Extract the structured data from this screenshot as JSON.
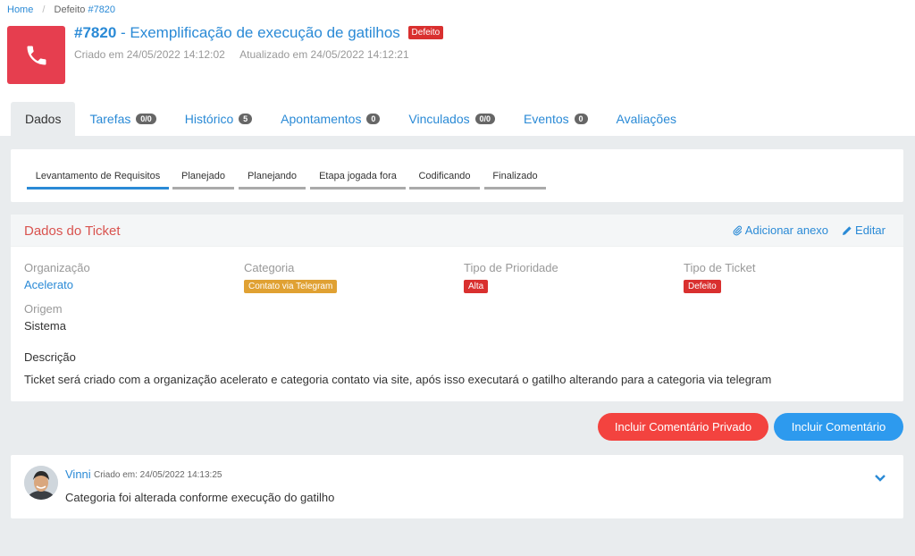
{
  "breadcrumb": {
    "home": "Home",
    "current_prefix": "Defeito",
    "current_id": "#7820"
  },
  "ticket": {
    "number": "#7820",
    "title": " - Exemplificação de execução de gatilhos",
    "type_badge": "Defeito",
    "created": "Criado em 24/05/2022 14:12:02",
    "updated": "Atualizado em 24/05/2022 14:12:21"
  },
  "tabs": [
    {
      "label": "Dados"
    },
    {
      "label": "Tarefas",
      "badge": "0/0"
    },
    {
      "label": "Histórico",
      "badge": "5"
    },
    {
      "label": "Apontamentos",
      "badge": "0"
    },
    {
      "label": "Vinculados",
      "badge": "0/0"
    },
    {
      "label": "Eventos",
      "badge": "0"
    },
    {
      "label": "Avaliações"
    }
  ],
  "stages": [
    "Levantamento de Requisitos",
    "Planejado",
    "Planejando",
    "Etapa jogada fora",
    "Codificando",
    "Finalizado"
  ],
  "panel": {
    "title": "Dados do Ticket",
    "attach_label": "Adicionar anexo",
    "edit_label": "Editar",
    "org_label": "Organização",
    "org_value": "Acelerato",
    "cat_label": "Categoria",
    "cat_value": "Contato via Telegram",
    "prio_label": "Tipo de Prioridade",
    "prio_value": "Alta",
    "type_label": "Tipo de Ticket",
    "type_value": "Defeito",
    "origin_label": "Origem",
    "origin_value": "Sistema",
    "desc_label": "Descrição",
    "desc_value": "Ticket será criado com a organização acelerato e categoria contato via site, após isso executará o gatilho alterando para a categoria via telegram"
  },
  "buttons": {
    "private_comment": "Incluir Comentário Privado",
    "comment": "Incluir Comentário"
  },
  "comment": {
    "author": "Vinni",
    "date": "Criado em: 24/05/2022 14:13:25",
    "text": "Categoria foi alterada conforme execução do gatilho"
  },
  "colors": {
    "accent": "#2a8ad6",
    "danger": "#d9302f",
    "warning": "#e0a133",
    "private_button": "#f3433f",
    "comment_button": "#2d9aee"
  }
}
